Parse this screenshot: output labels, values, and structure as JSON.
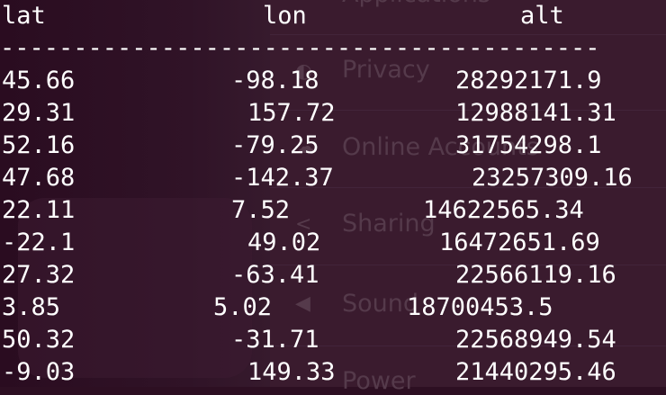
{
  "background_panel": {
    "items": [
      {
        "label": "Applications",
        "icon": "apps-icon"
      },
      {
        "label": "Privacy",
        "icon": "privacy-icon"
      },
      {
        "label": "Online Accounts",
        "icon": "accounts-icon"
      },
      {
        "label": "Sharing",
        "icon": "share-icon"
      },
      {
        "label": "Sound",
        "icon": "speaker-icon"
      },
      {
        "label": "Power",
        "icon": "power-icon"
      }
    ]
  },
  "terminal": {
    "headers": {
      "lat": "lat",
      "lon": "lon",
      "alt": "alt"
    },
    "rule": "-----------------------------------------",
    "rows": [
      {
        "lat": "45.66",
        "lon": "-98.18",
        "alt": "28292171.9"
      },
      {
        "lat": "29.31",
        "lon": "157.72",
        "alt": "12988141.31"
      },
      {
        "lat": "52.16",
        "lon": "-79.25",
        "alt": "31754298.1"
      },
      {
        "lat": "47.68",
        "lon": "-142.37",
        "alt": "23257309.16"
      },
      {
        "lat": "22.11",
        "lon": "7.52",
        "alt": "14622565.34"
      },
      {
        "lat": "-22.1",
        "lon": "49.02",
        "alt": "16472651.69"
      },
      {
        "lat": "27.32",
        "lon": "-63.41",
        "alt": "22566119.16"
      },
      {
        "lat": "3.85",
        "lon": "5.02",
        "alt": "18700453.5"
      },
      {
        "lat": "50.32",
        "lon": "-31.71",
        "alt": "22568949.54"
      },
      {
        "lat": "-9.03",
        "lon": "149.33",
        "alt": "21440295.46"
      }
    ]
  },
  "colors": {
    "background": "#2d0f22",
    "text": "#ffffff"
  }
}
